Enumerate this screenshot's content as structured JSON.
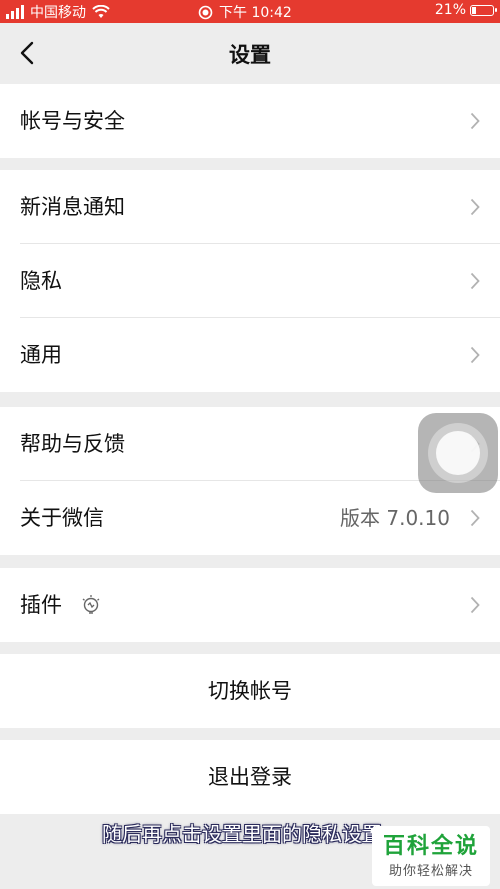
{
  "status_bar": {
    "carrier": "中国移动",
    "time": "下午 10:42",
    "battery": "21%",
    "battery_level": 0.21,
    "icons": [
      "signal-icon",
      "wifi-icon",
      "location-icon",
      "battery-icon"
    ]
  },
  "nav": {
    "title": "设置",
    "back_icon": "chevron-left-icon"
  },
  "groups": {
    "account": {
      "label": "帐号与安全"
    },
    "notifications": {
      "new_message": "新消息通知",
      "privacy": "隐私",
      "general": "通用"
    },
    "about": {
      "help": "帮助与反馈",
      "about_wechat": "关于微信",
      "version": "版本 7.0.10"
    },
    "plugins": {
      "label": "插件",
      "icon": "bulb-icon"
    },
    "switch_account": "切换帐号",
    "logout": "退出登录"
  },
  "overlay": {
    "caption": "随后再点击设置里面的隐私设置",
    "watermark_title": "百科全说",
    "watermark_subtitle": "助你轻松解决"
  },
  "colors": {
    "status_bar": "#e53a2f",
    "background": "#ededed",
    "watermark_green": "#1fa33a"
  }
}
